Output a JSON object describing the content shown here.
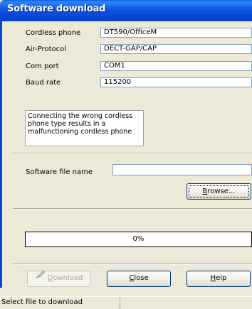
{
  "window": {
    "title": "Software download"
  },
  "form": {
    "cordless_phone": {
      "label": "Cordless phone",
      "value": "DT590/OfficeM"
    },
    "air_protocol": {
      "label": "Air-Protocol",
      "value": "DECT-GAP/CAP"
    },
    "com_port": {
      "label": "Com port",
      "value": "COM1"
    },
    "baud_rate": {
      "label": "Baud rate",
      "value": "115200"
    },
    "warning": "Connecting the wrong cordless phone type results in a malfunctioning cordless phone",
    "software_file": {
      "label": "Software file name",
      "value": ""
    }
  },
  "buttons": {
    "browse": {
      "mnemonic": "B",
      "rest": "rowse..."
    },
    "download": {
      "mnemonic": "D",
      "rest": "ownload",
      "enabled": false
    },
    "close": {
      "mnemonic": "C",
      "rest": "lose"
    },
    "help": {
      "mnemonic": "H",
      "rest": "elp"
    }
  },
  "progress": {
    "value": 0,
    "text": "0%"
  },
  "status": {
    "text": "Select file to download"
  },
  "icons": {
    "download": "pen-tool-icon"
  },
  "colors": {
    "titlebar": "#0a5fe8",
    "window_bg": "#ece9d8",
    "button_border": "#003c74",
    "disabled_text": "#aca899"
  }
}
